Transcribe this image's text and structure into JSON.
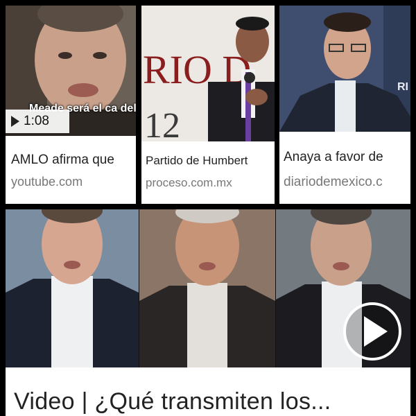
{
  "cards": [
    {
      "thumb_caption": "Meade será el ca del... AMLO",
      "duration": "1:08",
      "title": "AMLO afirma que",
      "source": "youtube.com"
    },
    {
      "backdrop_text": "RIO D",
      "backdrop_number": "12",
      "title": "Partido de Humbert",
      "source": "proceso.com.mx"
    },
    {
      "backdrop_text": "RI",
      "title": "Anaya a favor de",
      "source": "diariodemexico.c"
    }
  ],
  "featured": {
    "title": "Video | ¿Qué transmiten los..."
  },
  "colors": {
    "frame": "#000000",
    "card_bg": "#ffffff",
    "title_text": "#222222",
    "source_text": "#777777"
  },
  "icons": {
    "duration_play": "play-icon",
    "featured_play": "play-circle-icon"
  }
}
